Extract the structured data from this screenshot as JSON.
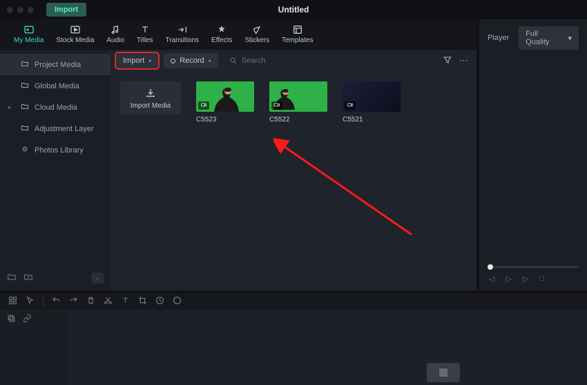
{
  "titlebar": {
    "tab": "Import",
    "title": "Untitled"
  },
  "tabs": {
    "my_media": "My Media",
    "stock_media": "Stock Media",
    "audio": "Audio",
    "titles": "Titles",
    "transitions": "Transitions",
    "effects": "Effects",
    "stickers": "Stickers",
    "templates": "Templates"
  },
  "sidebar": {
    "items": [
      {
        "label": "Project Media",
        "active": true
      },
      {
        "label": "Global Media"
      },
      {
        "label": "Cloud Media",
        "chev": true
      },
      {
        "label": "Adjustment Layer"
      },
      {
        "label": "Photos Library"
      }
    ]
  },
  "toolbar": {
    "import_label": "Import",
    "record_label": "Record",
    "search_placeholder": "Search"
  },
  "cards": {
    "import_media": "Import Media",
    "c0": "C5523",
    "c1": "C5522",
    "c2": "C5521"
  },
  "player": {
    "label": "Player",
    "quality": "Full Quality"
  }
}
